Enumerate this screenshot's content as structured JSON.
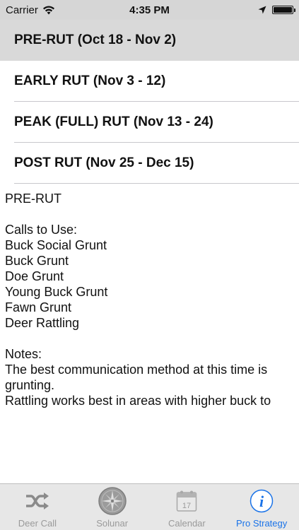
{
  "status_bar": {
    "carrier": "Carrier",
    "time": "4:35 PM",
    "battery_level": 1.0
  },
  "rut_list": {
    "items": [
      {
        "label": "PRE-RUT (Oct 18 - Nov 2)",
        "selected": true
      },
      {
        "label": "EARLY RUT (Nov 3 - 12)",
        "selected": false
      },
      {
        "label": "PEAK (FULL) RUT (Nov 13 -  24)",
        "selected": false
      },
      {
        "label": "POST RUT (Nov 25 - Dec 15)",
        "selected": false
      }
    ]
  },
  "detail": {
    "title": "PRE-RUT",
    "calls_heading": "Calls to Use:",
    "calls": [
      "Buck Social Grunt",
      "Buck Grunt",
      "Doe Grunt",
      "Young Buck Grunt",
      "Fawn Grunt",
      "Deer Rattling"
    ],
    "notes_heading": "Notes:",
    "notes_line1": "The best communication method at this time is grunting.",
    "notes_line2": "Rattling works best in areas with higher buck to"
  },
  "tab_bar": {
    "tabs": [
      {
        "label": "Deer Call",
        "icon": "shuffle-icon",
        "active": false
      },
      {
        "label": "Solunar",
        "icon": "compass-icon",
        "active": false
      },
      {
        "label": "Calendar",
        "icon": "calendar-icon",
        "active": false,
        "calendar_day": "17"
      },
      {
        "label": "Pro Strategy",
        "icon": "info-icon",
        "active": true
      }
    ]
  },
  "colors": {
    "accent": "#1a73e8",
    "inactive": "#9a9a9a",
    "selected_row": "#d9d9d9"
  }
}
